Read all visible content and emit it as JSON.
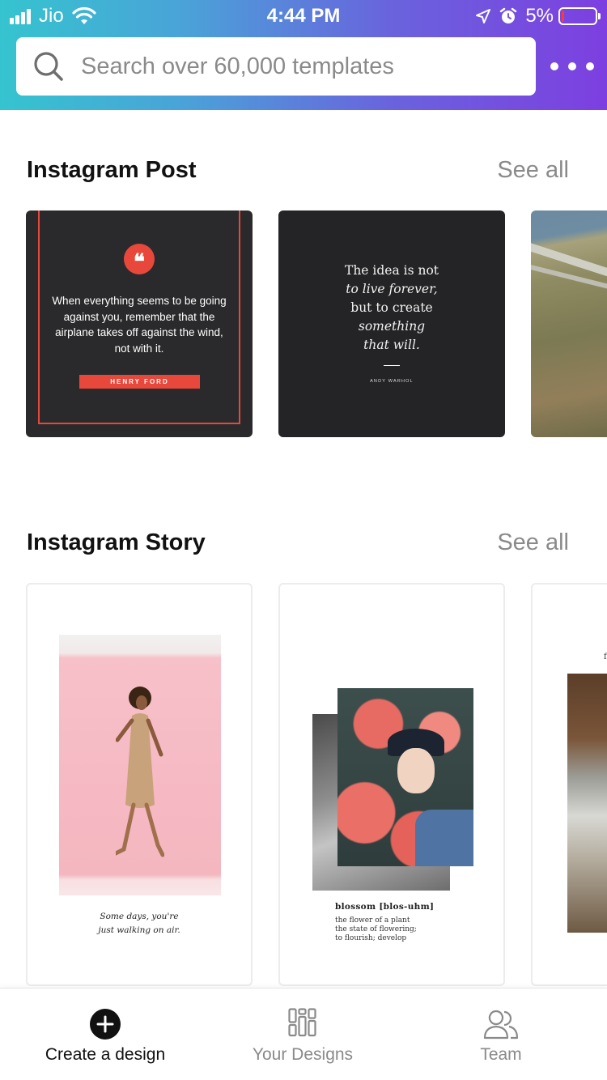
{
  "status_bar": {
    "carrier": "Jio",
    "time": "4:44 PM",
    "battery_percent": "5%",
    "battery_level": 0.05,
    "icons": [
      "signal-icon",
      "wifi-icon",
      "location-arrow-icon",
      "alarm-icon",
      "battery-icon"
    ]
  },
  "search": {
    "placeholder": "Search over 60,000 templates",
    "value": "",
    "icon": "search-icon"
  },
  "header": {
    "more_icon": "more-horizontal-icon",
    "gradient_colors": [
      "#35c4cf",
      "#7d3fe0"
    ]
  },
  "sections": [
    {
      "title": "Instagram Post",
      "see_all": "See all",
      "cards": [
        {
          "quote_mark": "❝",
          "quote": "When everything seems to be going against you, remember that the airplane takes off against the wind, not with it.",
          "author": "HENRY FORD",
          "accent": "#e8473b"
        },
        {
          "lines": [
            "The idea is not",
            "to live forever,",
            "but to create",
            "something",
            "that will."
          ],
          "author": "ANDY WARHOL"
        },
        {
          "image": "aerial-landscape"
        }
      ]
    },
    {
      "title": "Instagram Story",
      "see_all": "See all",
      "cards": [
        {
          "caption_lines": [
            "Some days, you're",
            "just walking on air."
          ]
        },
        {
          "title": "blossom [blos-uhm]",
          "definition_lines": [
            "the flower of a plant",
            "the state of flowering;",
            "to flourish; develop"
          ]
        },
        {
          "fragment": "f"
        }
      ]
    }
  ],
  "tabbar": {
    "tabs": [
      {
        "label": "Create a design",
        "icon": "plus-circle-icon",
        "active": true
      },
      {
        "label": "Your Designs",
        "icon": "designs-grid-icon",
        "active": false
      },
      {
        "label": "Team",
        "icon": "team-icon",
        "active": false
      }
    ]
  }
}
